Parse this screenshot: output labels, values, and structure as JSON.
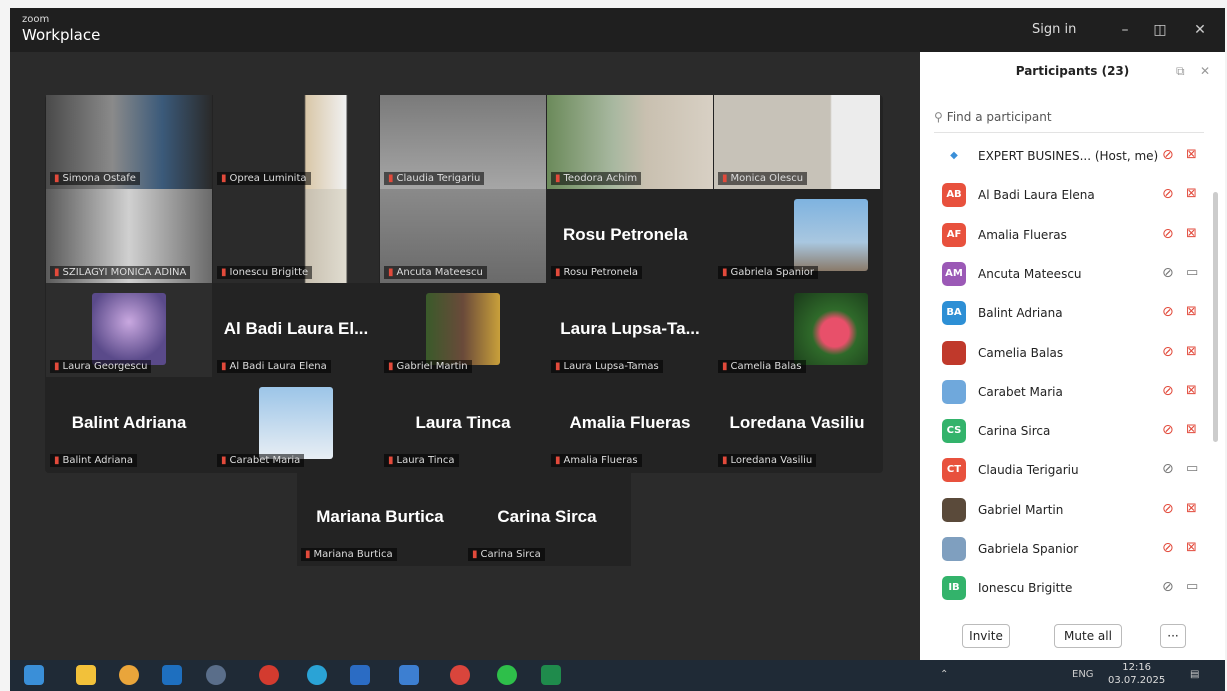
{
  "titlebar": {
    "brand_small": "zoom",
    "brand": "Workplace",
    "signin": "Sign in",
    "minimize": "–",
    "restore": "◫",
    "close": "✕"
  },
  "gallery": {
    "tiles": [
      {
        "label": "Simona Ostafe",
        "big": ""
      },
      {
        "label": "Oprea Luminita",
        "big": ""
      },
      {
        "label": "Claudia Terigariu",
        "big": ""
      },
      {
        "label": "Teodora Achim",
        "big": ""
      },
      {
        "label": "Monica Olescu",
        "big": ""
      },
      {
        "label": "SZILAGYI MONICA ADINA",
        "big": ""
      },
      {
        "label": "Ionescu Brigitte",
        "big": ""
      },
      {
        "label": "Ancuta Mateescu",
        "big": ""
      },
      {
        "label": "Rosu Petronela",
        "big": "Rosu Petronela"
      },
      {
        "label": "Gabriela Spanior",
        "big": ""
      },
      {
        "label": "Laura Georgescu",
        "big": ""
      },
      {
        "label": "Al Badi Laura Elena",
        "big": "Al Badi Laura El..."
      },
      {
        "label": "Gabriel Martin",
        "big": ""
      },
      {
        "label": "Laura Lupsa-Tamas",
        "big": "Laura Lupsa-Ta..."
      },
      {
        "label": "Camelia Balas",
        "big": ""
      },
      {
        "label": "Balint Adriana",
        "big": "Balint Adriana"
      },
      {
        "label": "Carabet Maria",
        "big": ""
      },
      {
        "label": "Laura Tinca",
        "big": "Laura Tinca"
      },
      {
        "label": "Amalia Flueras",
        "big": "Amalia Flueras"
      },
      {
        "label": "Loredana Vasiliu",
        "big": "Loredana Vasiliu"
      },
      {
        "label": "Mariana Burtica",
        "big": "Mariana Burtica"
      },
      {
        "label": "Carina Sirca",
        "big": "Carina Sirca"
      }
    ]
  },
  "participants": {
    "title": "Participants (23)",
    "search_placeholder": "Find a participant",
    "list": [
      {
        "initials": "",
        "name": "EXPERT BUSINES... (Host, me)",
        "color": "#ffffff",
        "mic": "muted",
        "cam": "off"
      },
      {
        "initials": "AB",
        "name": "Al Badi Laura Elena",
        "color": "#e8513d",
        "mic": "muted",
        "cam": "off"
      },
      {
        "initials": "AF",
        "name": "Amalia Flueras",
        "color": "#e8513d",
        "mic": "muted",
        "cam": "off"
      },
      {
        "initials": "AM",
        "name": "Ancuta Mateescu",
        "color": "#9b59b6",
        "mic": "muted-gray",
        "cam": "on"
      },
      {
        "initials": "BA",
        "name": "Balint Adriana",
        "color": "#2d8fd5",
        "mic": "muted",
        "cam": "off"
      },
      {
        "initials": "",
        "name": "Camelia Balas",
        "color": "#c0392b",
        "mic": "muted",
        "cam": "off"
      },
      {
        "initials": "",
        "name": "Carabet Maria",
        "color": "#6fa8dc",
        "mic": "muted",
        "cam": "off"
      },
      {
        "initials": "CS",
        "name": "Carina Sirca",
        "color": "#33b36b",
        "mic": "muted",
        "cam": "off"
      },
      {
        "initials": "CT",
        "name": "Claudia Terigariu",
        "color": "#e8513d",
        "mic": "muted-gray",
        "cam": "on"
      },
      {
        "initials": "",
        "name": "Gabriel Martin",
        "color": "#5a4a3a",
        "mic": "muted",
        "cam": "off"
      },
      {
        "initials": "",
        "name": "Gabriela Spanior",
        "color": "#7f9fbf",
        "mic": "muted",
        "cam": "off"
      },
      {
        "initials": "IB",
        "name": "Ionescu Brigitte",
        "color": "#33b36b",
        "mic": "muted-gray",
        "cam": "on"
      }
    ],
    "invite": "Invite",
    "mute_all": "Mute all",
    "more": "···"
  },
  "taskbar": {
    "language": "ENG",
    "time": "12:16",
    "date": "03.07.2025"
  }
}
